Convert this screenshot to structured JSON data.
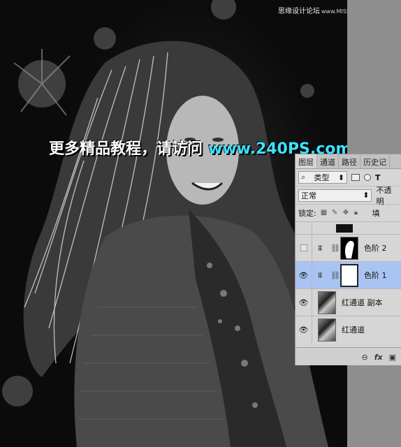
{
  "watermarks": {
    "top_cn": "思缘设计论坛",
    "top_url": "www.MISSYUAN.COM",
    "promo_cn": "更多精品教程，请访问",
    "promo_url": "www.240PS.com"
  },
  "panel": {
    "tabs": [
      "图层",
      "通道",
      "路径",
      "历史记"
    ],
    "kind_filter": "类型",
    "blend_mode": "正常",
    "opacity_label": "不透明",
    "lock_label": "锁定:",
    "fill_label": "填"
  },
  "layers": [
    {
      "name": "色阶 2",
      "visible": false,
      "type": "adjustment",
      "selected": false
    },
    {
      "name": "色阶 1",
      "visible": true,
      "type": "adjustment",
      "selected": true
    },
    {
      "name": "红通道 副本",
      "visible": true,
      "type": "pixel",
      "selected": false
    },
    {
      "name": "红通道",
      "visible": true,
      "type": "pixel",
      "selected": false
    }
  ],
  "colors": {
    "selected_layer": "#a9c4f2",
    "promo_url": "#3fe0ff"
  },
  "icons": {
    "bottom": [
      "link-icon",
      "fx-icon",
      "mask-icon"
    ]
  }
}
